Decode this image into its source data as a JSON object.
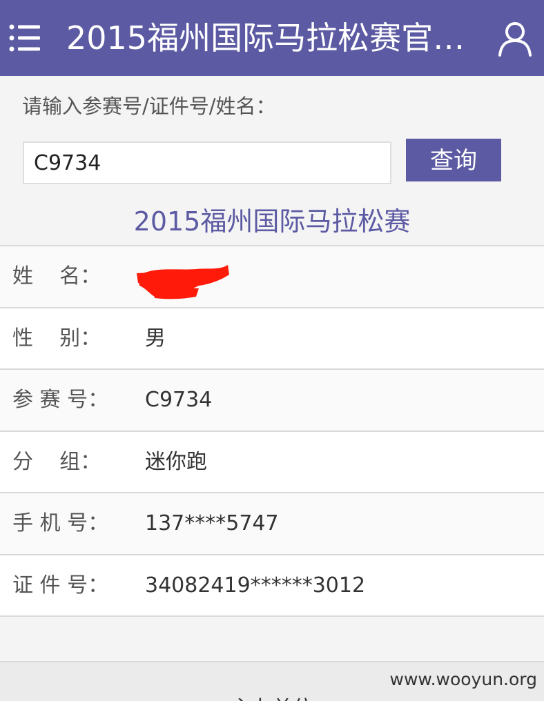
{
  "header": {
    "title": "2015福州国际马拉松赛官方…",
    "menu_icon": "menu-icon",
    "user_icon": "user-icon"
  },
  "search": {
    "prompt": "请输入参赛号/证件号/姓名：",
    "value": "C9734",
    "button_label": "查询"
  },
  "event_title": "2015福州国际马拉松赛",
  "info_rows": [
    {
      "label": "姓    名：",
      "value": ""
    },
    {
      "label": "性    别：",
      "value": "男"
    },
    {
      "label": "参 赛 号：",
      "value": "C9734"
    },
    {
      "label": "分    组：",
      "value": "迷你跑"
    },
    {
      "label": "手 机 号：",
      "value": "137****5747"
    },
    {
      "label": "证 件 号：",
      "value": "34082419******3012"
    }
  ],
  "footer": {
    "label": "主办单位"
  },
  "watermark": "www.wooyun.org",
  "colors": {
    "brand": "#5c5aa3",
    "redaction": "#ff1a0a"
  }
}
